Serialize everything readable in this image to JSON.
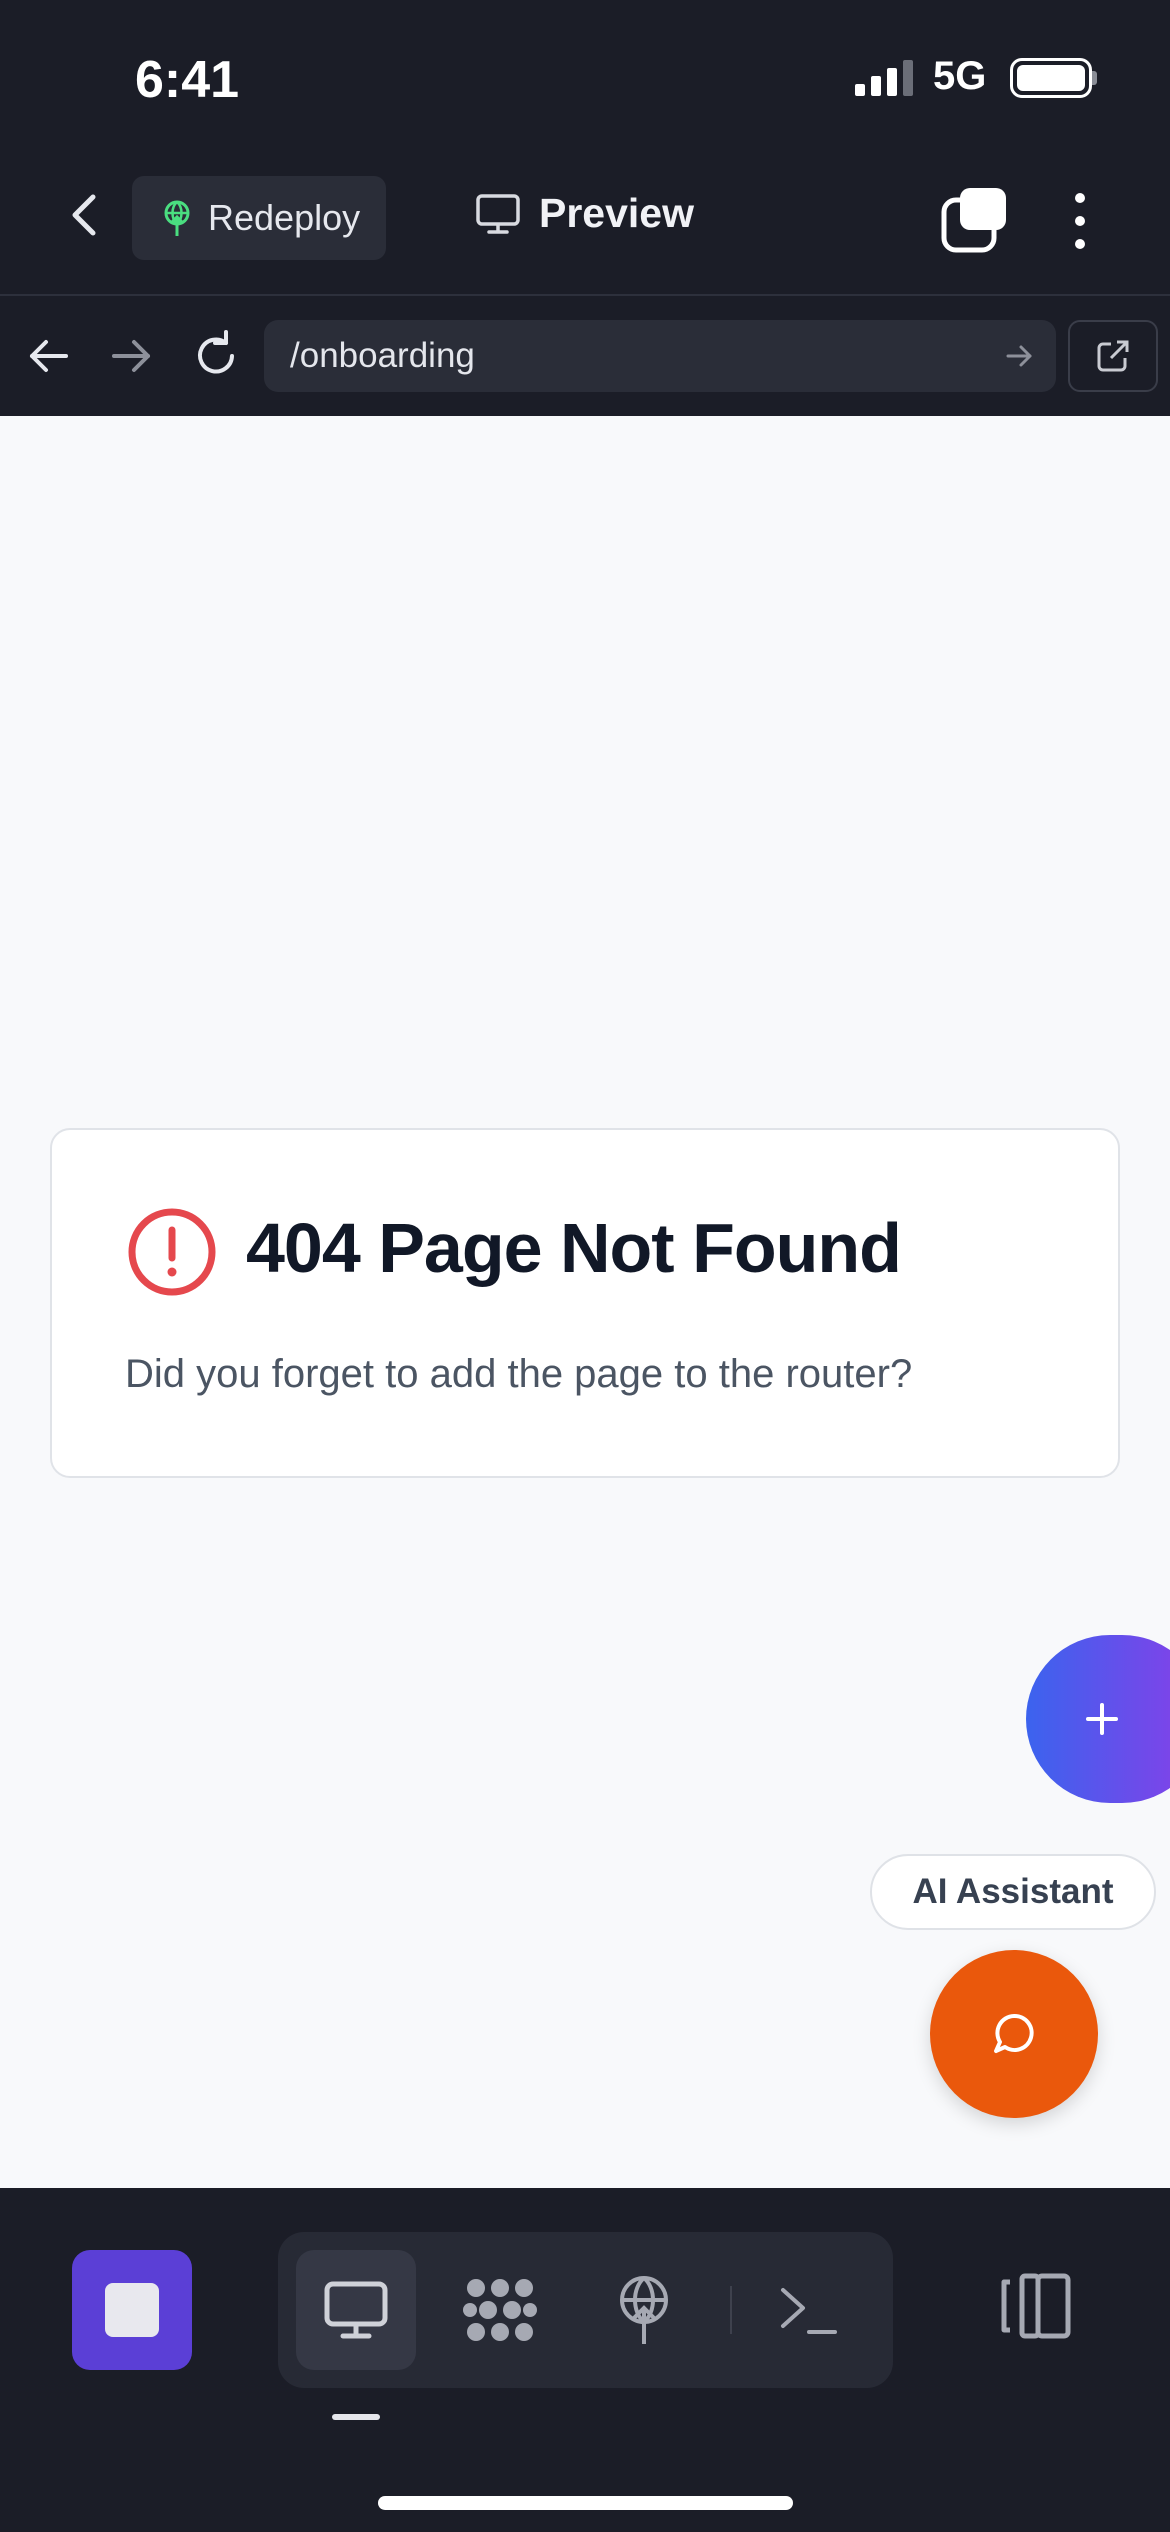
{
  "status": {
    "time": "6:41",
    "network": "5G"
  },
  "toolbar": {
    "redeploy_label": "Redeploy",
    "preview_label": "Preview"
  },
  "browser": {
    "url": "/onboarding"
  },
  "error": {
    "title": "404 Page Not Found",
    "message": "Did you forget to add the page to the router?"
  },
  "assistant": {
    "label": "AI Assistant"
  },
  "colors": {
    "dark_bg": "#1b1d27",
    "accent_purple": "#5b3fd6",
    "error_red": "#e5484d",
    "chat_orange": "#ea580c",
    "deploy_green": "#4ade80"
  },
  "bottom_nav": {
    "items": [
      "preview-icon",
      "services-icon",
      "deploy-icon",
      "terminal-icon"
    ],
    "active": "preview-icon"
  }
}
